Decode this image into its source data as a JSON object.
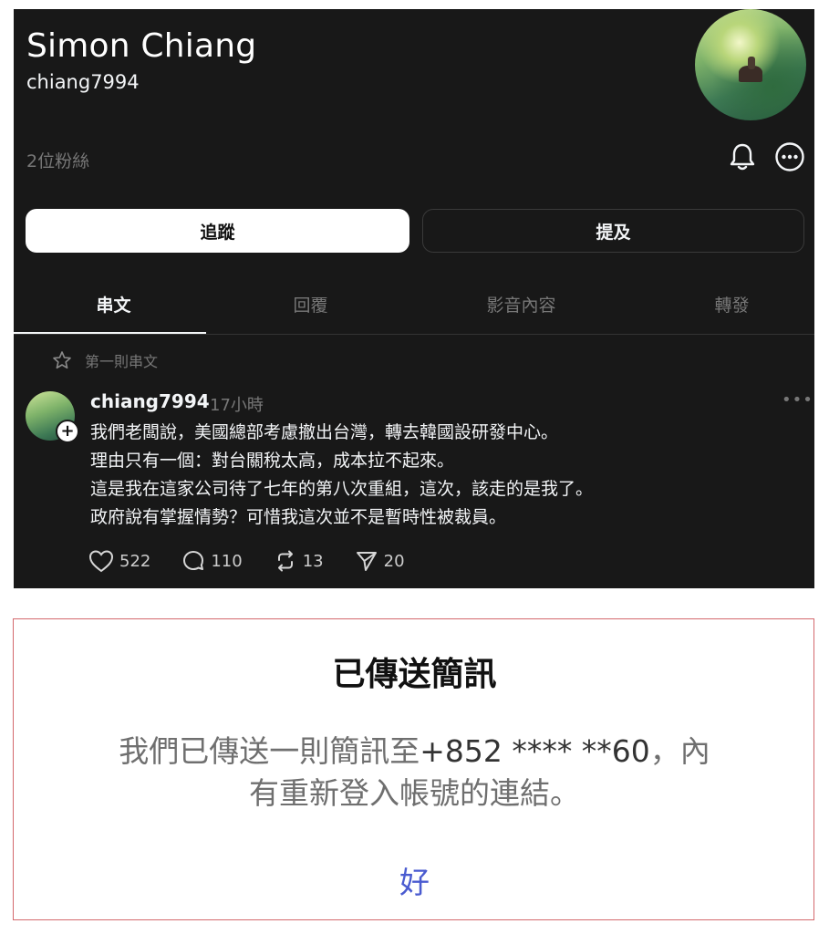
{
  "profile": {
    "name": "Simon Chiang",
    "handle": "chiang7994",
    "followers": "2位粉絲"
  },
  "buttons": {
    "follow": "追蹤",
    "mention": "提及"
  },
  "tabs": [
    {
      "label": "串文",
      "active": true
    },
    {
      "label": "回覆",
      "active": false
    },
    {
      "label": "影音內容",
      "active": false
    },
    {
      "label": "轉發",
      "active": false
    }
  ],
  "post": {
    "pinned_label": "第一則串文",
    "username": "chiang7994",
    "time": "17小時",
    "lines": [
      "我們老闆說，美國總部考慮撤出台灣，轉去韓國設研發中心。",
      "理由只有一個：對台關稅太高，成本拉不起來。",
      "這是我在這家公司待了七年的第八次重組，這次，該走的是我了。",
      "政府說有掌握情勢？可惜我這次並不是暫時性被裁員。"
    ],
    "likes": "522",
    "comments": "110",
    "reposts": "13",
    "shares": "20"
  },
  "dialog": {
    "title": "已傳送簡訊",
    "text_before": "我們已傳送一則簡訊至",
    "phone": "+852 **** **60",
    "text_after_line1": "，內",
    "text_line2": "有重新登入帳號的連結。",
    "ok": "好"
  },
  "colors": {
    "panel_bg": "#181818",
    "dialog_border": "#d4696d",
    "ok_blue": "#4a5bd0"
  }
}
